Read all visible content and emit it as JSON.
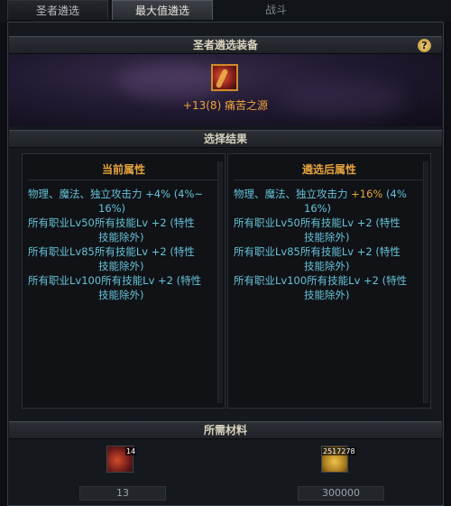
{
  "tabs": [
    "圣者遴选",
    "最大值遴选",
    "战斗"
  ],
  "header": {
    "title": "圣者遴选装备",
    "help_icon": "question-icon"
  },
  "item": {
    "name": "+13(8) 痛苦之源",
    "icon": "item-icon"
  },
  "result_section": {
    "title": "选择结果"
  },
  "current": {
    "title": "当前属性",
    "lines": [
      "物理、魔法、独立攻击力 +4% (4%~",
      "16%)",
      "所有职业Lv50所有技能Lv +2 (特性",
      "技能除外)",
      "所有职业Lv85所有技能Lv +2 (特性",
      "技能除外)",
      "所有职业Lv100所有技能Lv +2 (特性",
      "技能除外)"
    ]
  },
  "after": {
    "title": "遴选后属性",
    "line1_prefix": "物理、魔法、独立攻击力 ",
    "line1_value": "+16%",
    "line1_suffix": " (4%",
    "lines": [
      "16%)",
      "所有职业Lv50所有技能Lv +2 (特性",
      "技能除外)",
      "所有职业Lv85所有技能Lv +2 (特性",
      "技能除外)",
      "所有职业Lv100所有技能Lv +2 (特性",
      "技能除外)"
    ]
  },
  "materials": {
    "title": "所需材料",
    "items": [
      {
        "badge": "14",
        "count": "13",
        "icon": "pain-shard-icon"
      },
      {
        "badge": "2517278",
        "count": "300000",
        "icon": "gold-coin-icon"
      }
    ]
  }
}
